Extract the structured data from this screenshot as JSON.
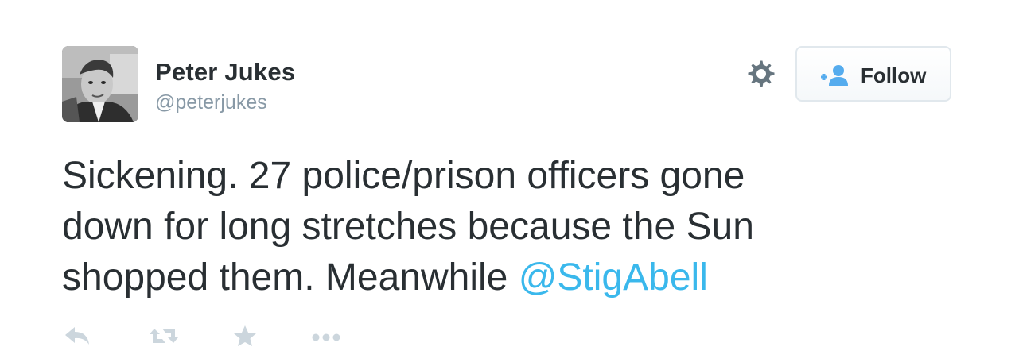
{
  "user": {
    "name": "Peter Jukes",
    "handle": "@peterjukes",
    "avatar_icon": "user-photo"
  },
  "header": {
    "settings_icon": "gear-icon",
    "follow_label": "Follow",
    "follow_icon": "add-user-icon"
  },
  "tweet": {
    "text_line1": "Sickening. 27 police/prison officers gone",
    "text_line2": "down for long stretches because the Sun",
    "text_line3_prefix": "shopped them. Meanwhile ",
    "mention": "@StigAbell"
  },
  "actions": {
    "reply_icon": "reply-icon",
    "retweet_icon": "retweet-icon",
    "favorite_icon": "star-icon",
    "more_icon": "more-icon"
  },
  "colors": {
    "text": "#292f33",
    "muted": "#8899a6",
    "link": "#3ab8ec",
    "icon": "#ccd6dd",
    "follow_icon": "#55acee"
  }
}
